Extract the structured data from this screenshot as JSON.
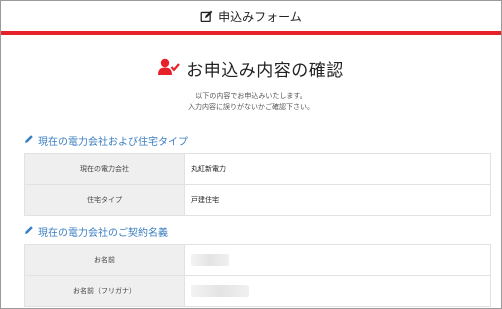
{
  "header": {
    "title": "申込みフォーム",
    "icon": "edit-icon"
  },
  "accent_colors": {
    "brand_red": "#e6212a",
    "section_blue": "#3a7ec1"
  },
  "page": {
    "title": "お申込み内容の確認",
    "icon": "user-check-icon",
    "intro_line1": "以下の内容でお申込みいたします。",
    "intro_line2": "入力内容に誤りがないかご確認下さい。"
  },
  "sections": [
    {
      "heading": "現在の電力会社および住宅タイプ",
      "icon": "pencil-icon",
      "rows": [
        {
          "label": "現在の電力会社",
          "value": "丸紅新電力"
        },
        {
          "label": "住宅タイプ",
          "value": "戸建住宅"
        }
      ]
    },
    {
      "heading": "現在の電力会社のご契約名義",
      "icon": "pencil-icon",
      "rows": [
        {
          "label": "お名前",
          "value": ""
        },
        {
          "label": "お名前（フリガナ）",
          "value": ""
        }
      ]
    }
  ]
}
